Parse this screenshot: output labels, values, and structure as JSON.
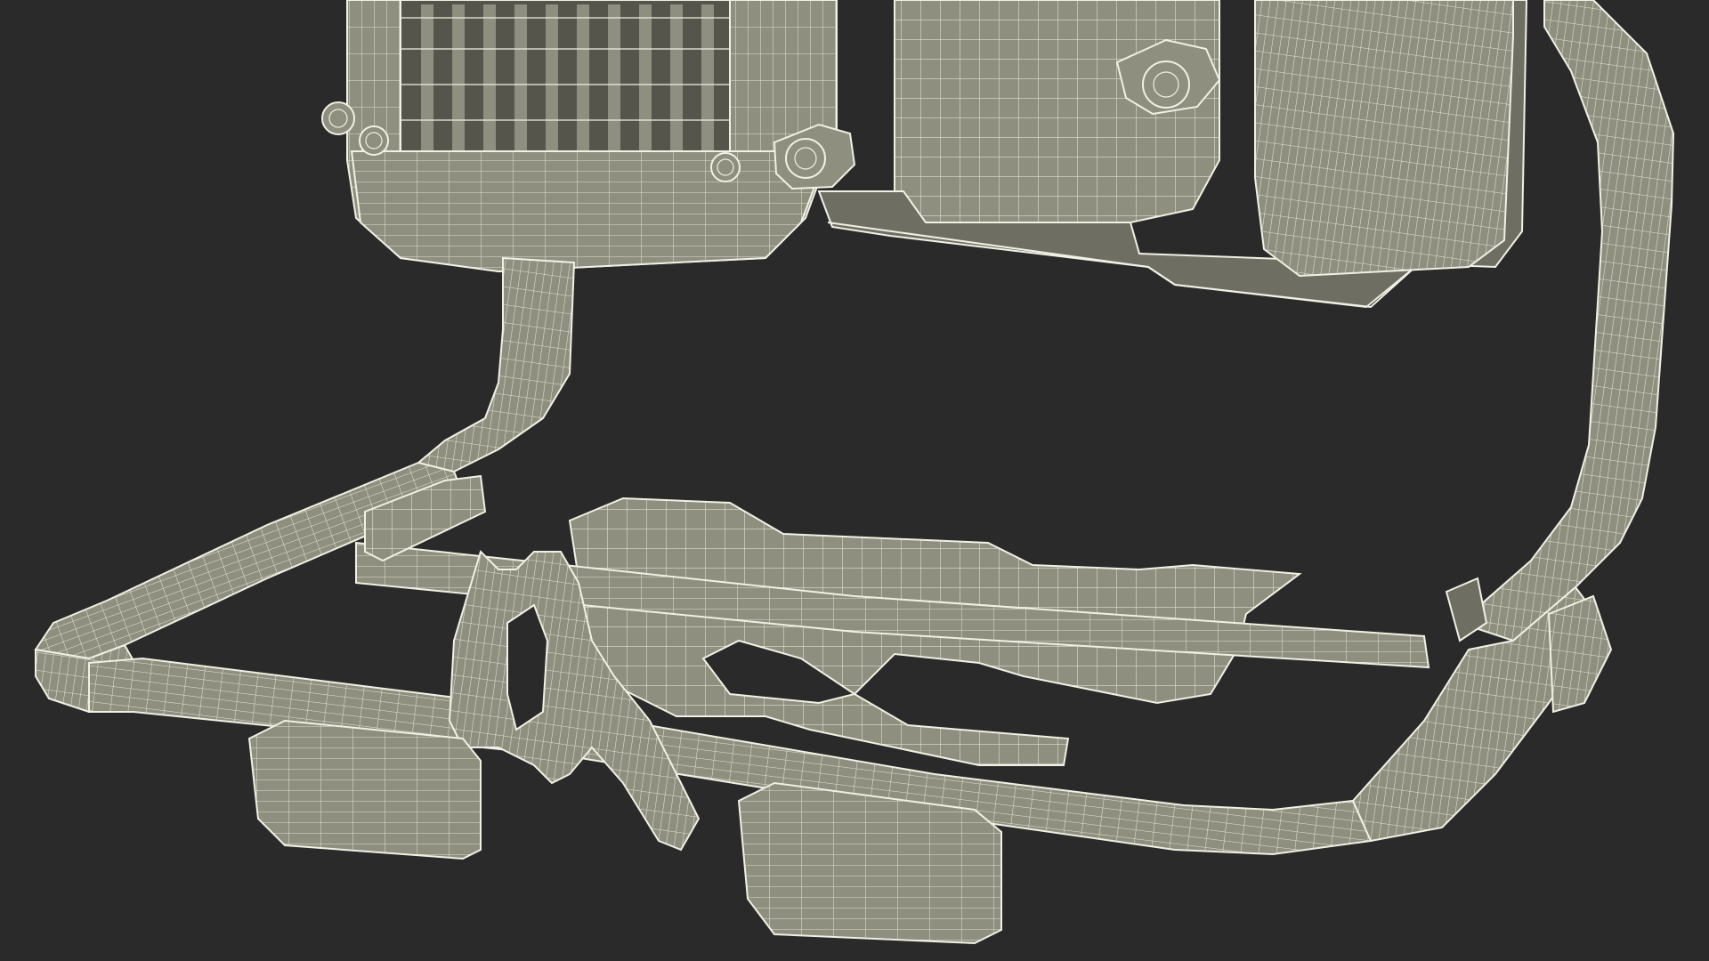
{
  "scene": {
    "background_color": "#2a2a2a",
    "surface_color": "#8f8f7f",
    "surface_shadow_color": "#6e6e62",
    "surface_dark_color": "#55554c",
    "wire_color": "#f0f0e4",
    "subject": "wireframe-render-of-portable-work-light-base-frame"
  }
}
